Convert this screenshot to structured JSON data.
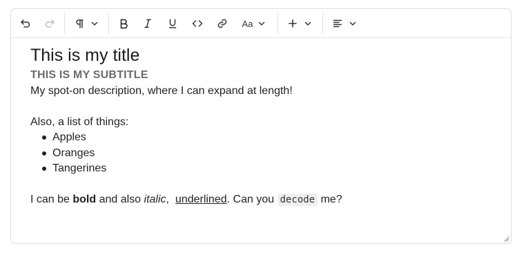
{
  "toolbar": {
    "undo": "undo",
    "redo": "redo",
    "paragraph": "paragraph",
    "bold": "bold",
    "italic": "italic",
    "underline": "underline",
    "code": "code",
    "link": "link",
    "font_size_label": "Aa",
    "insert": "insert",
    "align": "align-left"
  },
  "document": {
    "title": "This is my title",
    "subtitle": "THIS IS MY SUBTITLE",
    "description": "My spot-on description, where I can expand at length!",
    "list_intro": "Also, a list of things:",
    "list_items": [
      "Apples",
      "Oranges",
      "Tangerines"
    ],
    "final": {
      "part1": "I can be ",
      "bold": "bold",
      "part2": " and also ",
      "italic": "italic",
      "part3": ",  ",
      "underlined": "underlined",
      "part4": ". Can you ",
      "code": "decode",
      "part5": " me?"
    }
  }
}
